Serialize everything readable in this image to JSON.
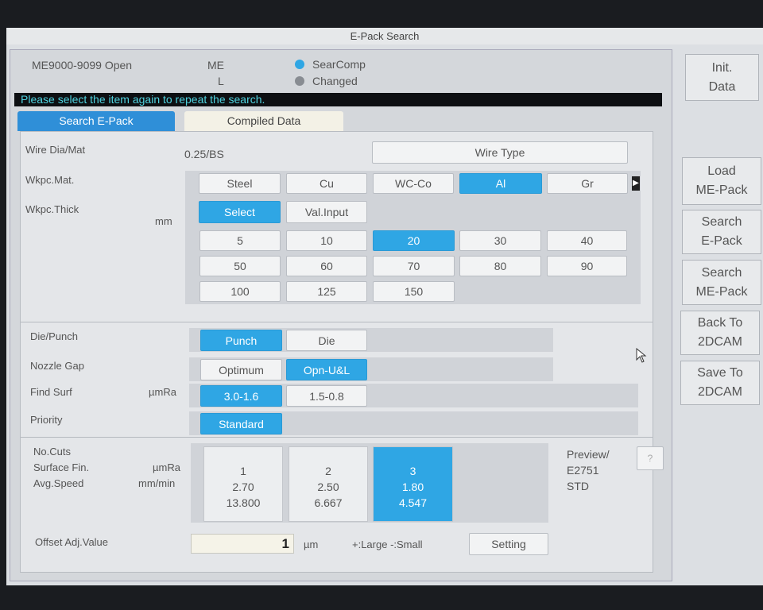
{
  "window": {
    "title": "E-Pack Search"
  },
  "header": {
    "range": "ME9000-9099 Open",
    "me": "ME",
    "l": "L",
    "radio_searcomp": "SearComp",
    "radio_changed": "Changed"
  },
  "message": "Please select the item again to repeat the search.",
  "tabs": [
    {
      "label": "Search E-Pack",
      "active": true
    },
    {
      "label": "Compiled Data",
      "active": false
    }
  ],
  "wire": {
    "label": "Wire Dia/Mat",
    "value": "0.25/BS",
    "button": "Wire Type"
  },
  "wkpc_mat": {
    "label": "Wkpc.Mat.",
    "options": [
      "Steel",
      "Cu",
      "WC-Co",
      "Al",
      "Gr"
    ],
    "selected": "Al"
  },
  "wkpc_thick": {
    "label": "Wkpc.Thick",
    "unit": "mm",
    "modes": [
      "Select",
      "Val.Input"
    ],
    "mode_selected": "Select",
    "values": [
      "5",
      "10",
      "20",
      "30",
      "40",
      "50",
      "60",
      "70",
      "80",
      "90",
      "100",
      "125",
      "150"
    ],
    "selected": "20"
  },
  "die_punch": {
    "label": "Die/Punch",
    "options": [
      "Punch",
      "Die"
    ],
    "selected": "Punch"
  },
  "nozzle_gap": {
    "label": "Nozzle Gap",
    "options": [
      "Optimum",
      "Opn-U&L"
    ],
    "selected": "Opn-U&L"
  },
  "find_surf": {
    "label": "Find Surf",
    "unit": "µmRa",
    "options": [
      "3.0-1.6",
      "1.5-0.8"
    ],
    "selected": "3.0-1.6"
  },
  "priority": {
    "label": "Priority",
    "options": [
      "Standard"
    ],
    "selected": "Standard"
  },
  "cuts": {
    "labels": [
      "No.Cuts",
      "Surface Fin.",
      "Avg.Speed"
    ],
    "units": [
      "µmRa",
      "mm/min"
    ],
    "cards": [
      {
        "cuts": "1",
        "surface": "2.70",
        "speed": "13.800"
      },
      {
        "cuts": "2",
        "surface": "2.50",
        "speed": "6.667"
      },
      {
        "cuts": "3",
        "surface": "1.80",
        "speed": "4.547",
        "selected": true
      }
    ],
    "preview": [
      "Preview/",
      "E2751",
      "STD"
    ],
    "help": "?"
  },
  "offset": {
    "label": "Offset Adj.Value",
    "value": "1",
    "unit": "µm",
    "hint": "+:Large -:Small",
    "button": "Setting"
  },
  "sidebar": {
    "init": [
      "Init.",
      "Data"
    ],
    "load_me": [
      "Load",
      "ME-Pack"
    ],
    "search_e": [
      "Search",
      "E-Pack"
    ],
    "search_me": [
      "Search",
      "ME-Pack"
    ],
    "back": [
      "Back To",
      "2DCAM"
    ],
    "save": [
      "Save To",
      "2DCAM"
    ]
  },
  "colors": {
    "accent": "#2fa6e4",
    "message_text": "#4fd3e0"
  }
}
